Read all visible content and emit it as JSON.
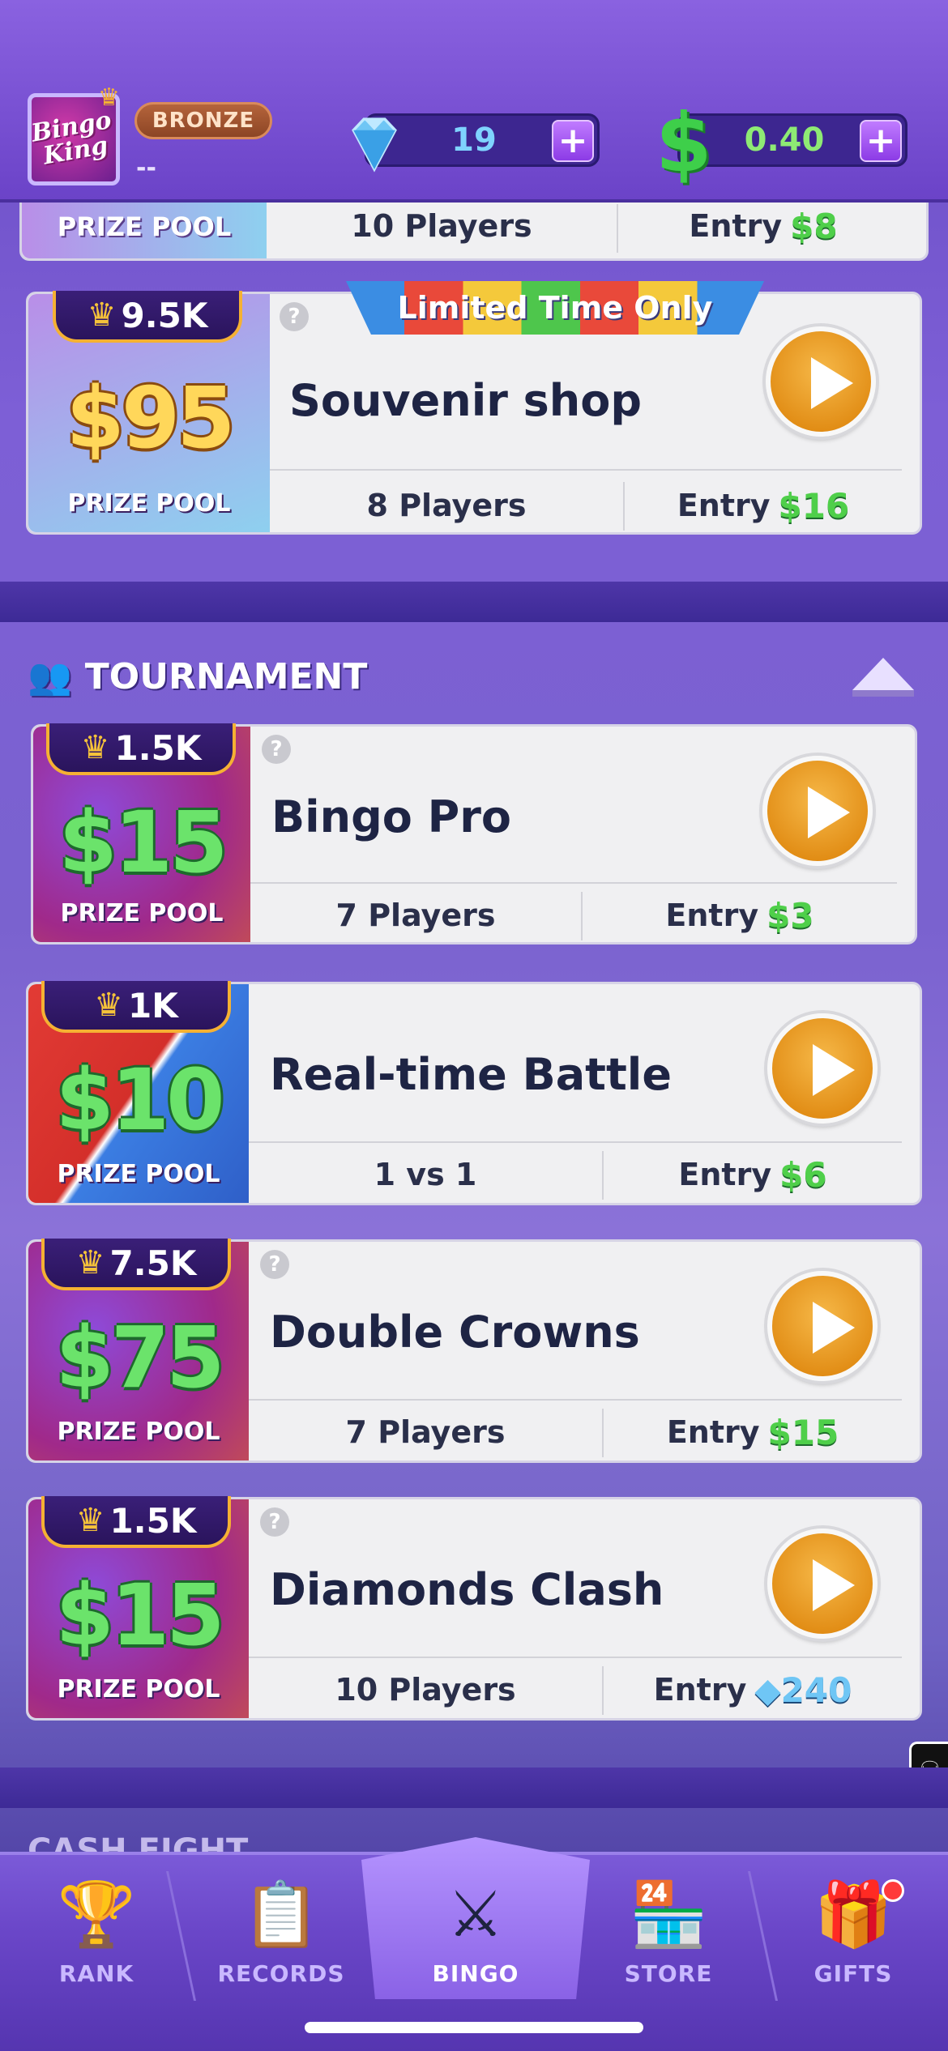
{
  "header": {
    "avatar_logo_line1": "Bingo",
    "avatar_logo_line2": "King",
    "rank": "BRONZE",
    "username": "--",
    "gems": "19",
    "cash": "0.40",
    "cash_symbol": "$",
    "plus": "+"
  },
  "partial_card": {
    "prize_label": "PRIZE POOL",
    "players": "10 Players",
    "entry_label": "Entry",
    "entry_amount": "$8"
  },
  "featured_card": {
    "banner": "Limited Time Only",
    "crowns": "9.5K",
    "prize": "$95",
    "prize_label": "PRIZE POOL",
    "title": "Souvenir shop",
    "players": "8 Players",
    "entry_label": "Entry",
    "entry_amount": "$16"
  },
  "tournament": {
    "section_title": "TOURNAMENT",
    "cards": [
      {
        "crowns": "1.5K",
        "prize": "$15",
        "prize_label": "PRIZE POOL",
        "title": "Bingo Pro",
        "players": "7 Players",
        "entry_label": "Entry",
        "entry_amount": "$3"
      },
      {
        "crowns": "1K",
        "prize": "$10",
        "prize_label": "PRIZE POOL",
        "title": "Real-time Battle",
        "players": "1 vs 1",
        "entry_label": "Entry",
        "entry_amount": "$6"
      },
      {
        "crowns": "7.5K",
        "prize": "$75",
        "prize_label": "PRIZE POOL",
        "title": "Double Crowns",
        "players": "7 Players",
        "entry_label": "Entry",
        "entry_amount": "$15"
      },
      {
        "crowns": "1.5K",
        "prize": "$15",
        "prize_label": "PRIZE POOL",
        "title": "Diamonds Clash",
        "players": "10 Players",
        "entry_label": "Entry",
        "entry_amount": "240"
      }
    ]
  },
  "next_section_partial": "CASH FIGHT",
  "nav": {
    "items": [
      {
        "label": "RANK",
        "icon": "trophy-icon"
      },
      {
        "label": "RECORDS",
        "icon": "records-icon"
      },
      {
        "label": "BINGO",
        "icon": "swords-icon"
      },
      {
        "label": "STORE",
        "icon": "store-icon"
      },
      {
        "label": "GIFTS",
        "icon": "gift-icon"
      }
    ],
    "active": "BINGO"
  },
  "colors": {
    "accent_purple": "#6b43c8",
    "play_orange": "#e08a12",
    "money_green": "#4fcf4a",
    "gem_blue": "#6fc6f5"
  }
}
